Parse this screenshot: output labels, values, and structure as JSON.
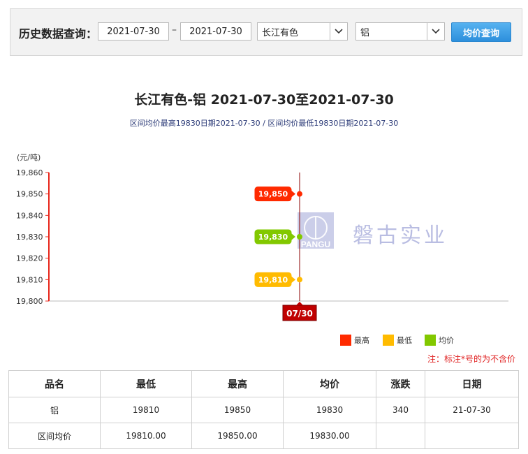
{
  "query": {
    "label": "历史数据查询：",
    "start_date": "2021-07-30",
    "separator": "–",
    "end_date": "2021-07-30",
    "market": "长江有色",
    "metal": "铝",
    "button": "均价查询"
  },
  "chart": {
    "title": "长江有色-铝 2021-07-30至2021-07-30",
    "subtitle": "区间均价最高19830日期2021-07-30 / 区间均价最低19830日期2021-07-30",
    "unit": "(元/吨)",
    "watermark": {
      "brand": "PANGU",
      "text": "磐古实业"
    }
  },
  "chart_data": {
    "type": "line",
    "x": [
      "07/30"
    ],
    "ylim": [
      19800,
      19860
    ],
    "yticks": [
      19800,
      19810,
      19820,
      19830,
      19840,
      19850,
      19860
    ],
    "ytick_labels": [
      "19,800",
      "19,810",
      "19,820",
      "19,830",
      "19,840",
      "19,850",
      "19,860"
    ],
    "series": [
      {
        "name": "最高",
        "values": [
          19850
        ],
        "color": "#ff2a00",
        "label": "19,850"
      },
      {
        "name": "最低",
        "values": [
          19810
        ],
        "color": "#ffbb00",
        "label": "19,810"
      },
      {
        "name": "均价",
        "values": [
          19830
        ],
        "color": "#82c800",
        "label": "19,830"
      }
    ],
    "legend_position": "bottom-right"
  },
  "note": "注：标注*号的为不含价",
  "table": {
    "headers": [
      "品名",
      "最低",
      "最高",
      "均价",
      "涨跌",
      "日期"
    ],
    "rows": [
      [
        "铝",
        "19810",
        "19850",
        "19830",
        "340",
        "21-07-30"
      ],
      [
        "区间均价",
        "19810.00",
        "19850.00",
        "19830.00",
        "",
        ""
      ]
    ]
  }
}
